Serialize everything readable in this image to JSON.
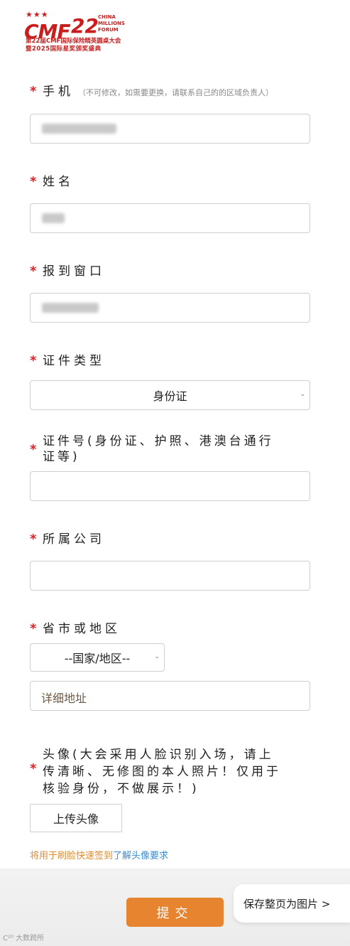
{
  "logo": {
    "stars": "★★★",
    "brand": "CMF",
    "edition_number": "22",
    "english_lines": [
      "CHINA",
      "MILLIONS",
      "FORUM"
    ],
    "line1": "第22届CMF国际保险精英圆桌大会",
    "line2": "暨2025国际星奖颁奖盛典"
  },
  "form": {
    "required_mark": "*",
    "phone": {
      "label": "手机",
      "hint": "（不可修改，如需要更换，请联系自己的的区域负责人）"
    },
    "name": {
      "label": "姓名"
    },
    "window": {
      "label": "报到窗口"
    },
    "id_type": {
      "label": "证件类型",
      "value": "身份证"
    },
    "id_number": {
      "label_line1": "证件号(身份证、护照、港澳台通行",
      "label_line2": "证等)"
    },
    "company": {
      "label": "所属公司"
    },
    "region": {
      "label": "省市或地区",
      "country_select": "--国家/地区--",
      "address_placeholder": "详细地址"
    },
    "avatar": {
      "label_line1": "头像(大会采用人脸识别入场，请上",
      "label_line2": "传清晰、无修图的本人照片！仅用于",
      "label_line3": "核验身份，不做展示！)",
      "upload_button": "上传头像",
      "note_orange": "将用于刷脸快速签到",
      "note_link": "了解头像要求"
    }
  },
  "footer": {
    "submit": "提交",
    "save_page": "保存整页为图片 >",
    "watermark": "C²⁰ 大数跨所"
  }
}
